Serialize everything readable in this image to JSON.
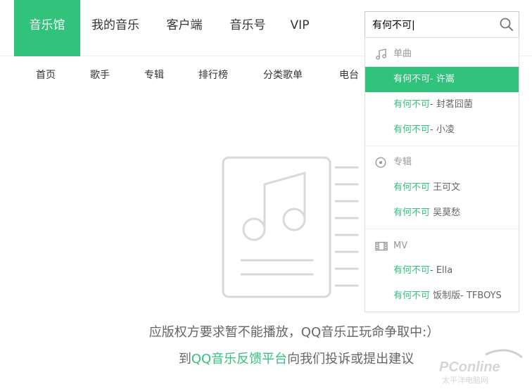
{
  "top_nav": {
    "items": [
      "音乐馆",
      "我的音乐",
      "客户端",
      "音乐号",
      "VIP"
    ],
    "active_index": 0
  },
  "search": {
    "value": "有何不可|",
    "icon": "search-icon"
  },
  "sub_nav": {
    "items": [
      "首页",
      "歌手",
      "专辑",
      "排行榜",
      "分类歌单",
      "电台"
    ]
  },
  "dropdown": {
    "sections": [
      {
        "title": "单曲",
        "icon": "music-note-icon",
        "rows": [
          {
            "highlight": "有何不可",
            "rest": "- 许嵩",
            "selected": true
          },
          {
            "highlight": "有何不可",
            "rest": "- 封茗囧菌",
            "selected": false
          },
          {
            "highlight": "有何不可",
            "rest": "- 小凌",
            "selected": false
          }
        ]
      },
      {
        "title": "专辑",
        "icon": "disc-icon",
        "rows": [
          {
            "highlight": "有何不可",
            "rest": " 王可文",
            "selected": false
          },
          {
            "highlight": "有何不可",
            "rest": " 吴莫愁",
            "selected": false
          }
        ]
      },
      {
        "title": "MV",
        "icon": "film-icon",
        "rows": [
          {
            "highlight": "有何不可",
            "rest": "- Ella",
            "selected": false
          },
          {
            "highlight": "有何不可",
            "rest": " 饭制版- TFBOYS",
            "selected": false
          }
        ]
      }
    ]
  },
  "empty_state": {
    "icon": "music-document-icon",
    "line1": "应版权方要求暂不能播放，QQ音乐正玩命争取中:）",
    "line2_prefix": "到",
    "line2_link": "QQ音乐反馈平台",
    "line2_suffix": "向我们投诉或提出建议"
  },
  "watermark": {
    "brand": "PConline",
    "subtitle": "太平洋电脑网"
  },
  "colors": {
    "accent": "#31c27c",
    "text": "#333333",
    "muted": "#999999",
    "border": "#dddddd"
  }
}
